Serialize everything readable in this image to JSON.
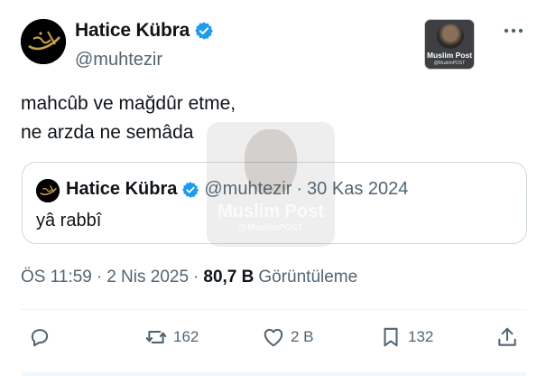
{
  "author": {
    "display_name": "Hatice Kübra",
    "handle": "@muhtezir",
    "avatar_icon": "calligraphy-avatar-icon",
    "verified_icon": "verified-badge-icon"
  },
  "brand": {
    "title": "Muslim Post",
    "sub": "@MuslimPOST"
  },
  "tweet": {
    "line1": "mahcûb ve mağdûr etme,",
    "line2": "ne arzda ne semâda"
  },
  "quote": {
    "display_name": "Hatice Kübra",
    "handle": "@muhtezir",
    "separator": "·",
    "date": "30 Kas 2024",
    "text": "yâ rabbî"
  },
  "watermark": {
    "title": "Muslim Post",
    "sub": "@MuslimPOST"
  },
  "meta": {
    "time": "ÖS 11:59",
    "sep1": "·",
    "date": "2 Nis 2025",
    "sep2": "·",
    "views_count": "80,7 B",
    "views_label": "Görüntüleme"
  },
  "actions": {
    "reply_icon": "reply-icon",
    "repost_icon": "repost-icon",
    "repost_count": "162",
    "like_icon": "like-icon",
    "like_count": "2 B",
    "bookmark_icon": "bookmark-icon",
    "bookmark_count": "132",
    "share_icon": "share-icon"
  },
  "colors": {
    "text": "#0f1419",
    "muted": "#536471",
    "verified": "#1d9bf0",
    "border": "#cfd9de"
  }
}
